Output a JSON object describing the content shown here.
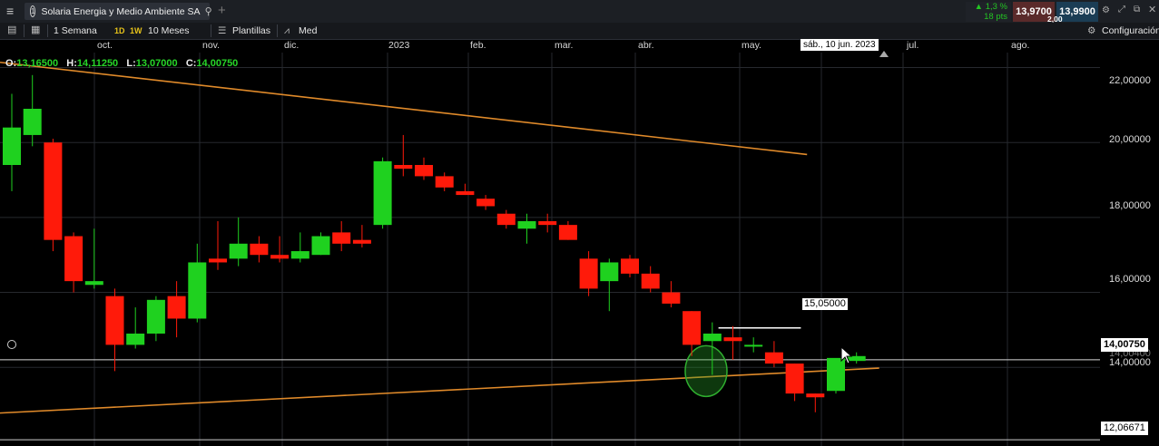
{
  "tab": {
    "index": "1",
    "title": "Solaria Energia y Medio Ambiente SA"
  },
  "toolbar": {
    "period": "1 Semana",
    "interval_1d": "1D",
    "interval_1w": "1W",
    "range": "10 Meses",
    "templates": "Plantillas",
    "med": "Med",
    "config": "Configuración"
  },
  "quote": {
    "change_pct": "1,3 %",
    "change_pts": "18 pts",
    "bid": "13,9700",
    "ask": "13,9900",
    "spread": "2,00"
  },
  "time_axis": {
    "months": [
      "oct.",
      "nov.",
      "dic.",
      "2023",
      "feb.",
      "mar.",
      "abr.",
      "may.",
      "jul.",
      "ago."
    ],
    "crosshair_date": "sáb., 10 jun. 2023"
  },
  "ohlc": {
    "o_label": "O:",
    "o_value": "13,16500",
    "h_label": "H:",
    "h_value": "14,11250",
    "l_label": "L:",
    "l_value": "13,07000",
    "c_label": "C:",
    "c_value": "14,00750"
  },
  "price_axis": {
    "ticks": [
      "22,00000",
      "20,00000",
      "18,00000",
      "16,00000",
      "14,00000"
    ],
    "current_price": "14,00750",
    "hidden_price": "14,00400",
    "support_price": "12,06671",
    "annotation_price": "15,05000"
  },
  "colors": {
    "up": "#1fd11f",
    "down": "#ff1a0a",
    "trend": "#e08a2a",
    "accent": "#e6c21a"
  },
  "chart_data": {
    "type": "candlestick",
    "interval": "weekly",
    "candles": [
      {
        "o": 19.4,
        "h": 21.3,
        "l": 18.7,
        "c": 20.4
      },
      {
        "o": 20.2,
        "h": 21.8,
        "l": 19.9,
        "c": 20.9
      },
      {
        "o": 20.0,
        "h": 20.1,
        "l": 17.1,
        "c": 17.4
      },
      {
        "o": 17.5,
        "h": 17.6,
        "l": 16.0,
        "c": 16.3
      },
      {
        "o": 16.2,
        "h": 17.7,
        "l": 16.1,
        "c": 16.3
      },
      {
        "o": 15.9,
        "h": 16.1,
        "l": 13.9,
        "c": 14.6
      },
      {
        "o": 14.6,
        "h": 15.6,
        "l": 14.5,
        "c": 14.9
      },
      {
        "o": 14.9,
        "h": 15.9,
        "l": 14.7,
        "c": 15.8
      },
      {
        "o": 15.9,
        "h": 16.3,
        "l": 14.8,
        "c": 15.3
      },
      {
        "o": 15.3,
        "h": 17.3,
        "l": 15.2,
        "c": 16.8
      },
      {
        "o": 16.9,
        "h": 17.9,
        "l": 16.6,
        "c": 16.8
      },
      {
        "o": 16.9,
        "h": 18.0,
        "l": 16.7,
        "c": 17.3
      },
      {
        "o": 17.3,
        "h": 17.5,
        "l": 16.8,
        "c": 17.0
      },
      {
        "o": 17.0,
        "h": 17.5,
        "l": 16.8,
        "c": 16.9
      },
      {
        "o": 16.9,
        "h": 17.6,
        "l": 16.8,
        "c": 17.1
      },
      {
        "o": 17.0,
        "h": 17.6,
        "l": 17.0,
        "c": 17.5
      },
      {
        "o": 17.6,
        "h": 17.9,
        "l": 17.1,
        "c": 17.3
      },
      {
        "o": 17.4,
        "h": 17.8,
        "l": 17.2,
        "c": 17.3
      },
      {
        "o": 17.8,
        "h": 19.6,
        "l": 17.7,
        "c": 19.5
      },
      {
        "o": 19.4,
        "h": 20.2,
        "l": 19.1,
        "c": 19.3
      },
      {
        "o": 19.4,
        "h": 19.6,
        "l": 19.0,
        "c": 19.1
      },
      {
        "o": 19.1,
        "h": 19.2,
        "l": 18.7,
        "c": 18.8
      },
      {
        "o": 18.7,
        "h": 18.9,
        "l": 18.6,
        "c": 18.6
      },
      {
        "o": 18.5,
        "h": 18.6,
        "l": 18.2,
        "c": 18.3
      },
      {
        "o": 18.1,
        "h": 18.2,
        "l": 17.7,
        "c": 17.8
      },
      {
        "o": 17.7,
        "h": 18.1,
        "l": 17.3,
        "c": 17.9
      },
      {
        "o": 17.9,
        "h": 18.1,
        "l": 17.6,
        "c": 17.8
      },
      {
        "o": 17.8,
        "h": 17.9,
        "l": 17.4,
        "c": 17.4
      },
      {
        "o": 16.9,
        "h": 17.1,
        "l": 15.9,
        "c": 16.1
      },
      {
        "o": 16.3,
        "h": 16.9,
        "l": 15.5,
        "c": 16.8
      },
      {
        "o": 16.9,
        "h": 17.0,
        "l": 16.4,
        "c": 16.5
      },
      {
        "o": 16.5,
        "h": 16.7,
        "l": 16.0,
        "c": 16.1
      },
      {
        "o": 16.0,
        "h": 16.3,
        "l": 15.6,
        "c": 15.7
      },
      {
        "o": 15.5,
        "h": 15.5,
        "l": 14.3,
        "c": 14.6
      },
      {
        "o": 14.7,
        "h": 15.2,
        "l": 13.8,
        "c": 14.9
      },
      {
        "o": 14.8,
        "h": 15.1,
        "l": 14.2,
        "c": 14.7
      },
      {
        "o": 14.6,
        "h": 14.8,
        "l": 14.4,
        "c": 14.6
      },
      {
        "o": 14.4,
        "h": 14.7,
        "l": 14.0,
        "c": 14.1
      },
      {
        "o": 14.1,
        "h": 14.1,
        "l": 13.1,
        "c": 13.3
      },
      {
        "o": 13.3,
        "h": 13.3,
        "l": 12.8,
        "c": 13.2
      },
      {
        "o": 13.37,
        "h": 14.2,
        "l": 13.3,
        "c": 14.25
      },
      {
        "o": 14.17,
        "h": 14.4,
        "l": 14.1,
        "c": 14.3
      }
    ],
    "y_range": [
      11.9,
      22.4
    ],
    "trendlines": [
      {
        "from": [
          0,
          22.14
        ],
        "to": [
          38.6,
          19.68
        ],
        "color": "orange"
      },
      {
        "from": [
          0,
          12.78
        ],
        "to": [
          42.1,
          13.98
        ],
        "color": "orange"
      }
    ],
    "horizontal_lines": [
      12.06671,
      14.2,
      15.05
    ],
    "highlight_ellipse": {
      "x": 33.7,
      "y": 13.9
    },
    "grid": true
  }
}
